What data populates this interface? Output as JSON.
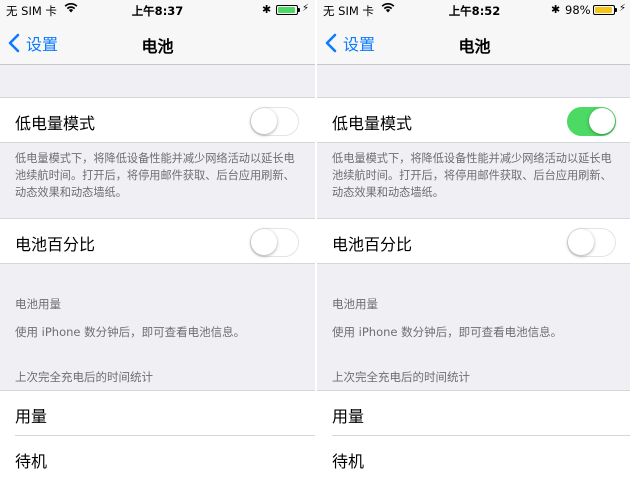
{
  "screens": [
    {
      "status": {
        "carrier": "无 SIM 卡",
        "time": "上午8:37",
        "battery_pct": "",
        "battery_level": 0.95,
        "battery_color": "#4cd964",
        "charging": true
      },
      "nav": {
        "back_label": "设置",
        "title": "电池"
      },
      "low_power": {
        "label": "低电量模式",
        "on": false,
        "footer": "低电量模式下，将降低设备性能并减少网络活动以延长电池续航时间。打开后，将停用邮件获取、后台应用刷新、动态效果和动态墙纸。"
      },
      "battery_pct_row": {
        "label": "电池百分比",
        "on": false
      },
      "usage": {
        "header": "电池用量",
        "note": "使用 iPhone 数分钟后，即可查看电池信息。"
      },
      "since": {
        "header": "上次完全充电后的时间统计",
        "rows": [
          "用量",
          "待机"
        ]
      }
    },
    {
      "status": {
        "carrier": "无 SIM 卡",
        "time": "上午8:52",
        "battery_pct": "98%",
        "battery_level": 0.95,
        "battery_color": "#f5c518",
        "charging": true
      },
      "nav": {
        "back_label": "设置",
        "title": "电池"
      },
      "low_power": {
        "label": "低电量模式",
        "on": true,
        "footer": "低电量模式下，将降低设备性能并减少网络活动以延长电池续航时间。打开后，将停用邮件获取、后台应用刷新、动态效果和动态墙纸。"
      },
      "battery_pct_row": {
        "label": "电池百分比",
        "on": false
      },
      "usage": {
        "header": "电池用量",
        "note": "使用 iPhone 数分钟后，即可查看电池信息。"
      },
      "since": {
        "header": "上次完全充电后的时间统计",
        "rows": [
          "用量",
          "待机"
        ]
      }
    }
  ],
  "colors": {
    "accent": "#0b7bff",
    "toggle_on": "#4cd964",
    "background": "#efeff4"
  }
}
